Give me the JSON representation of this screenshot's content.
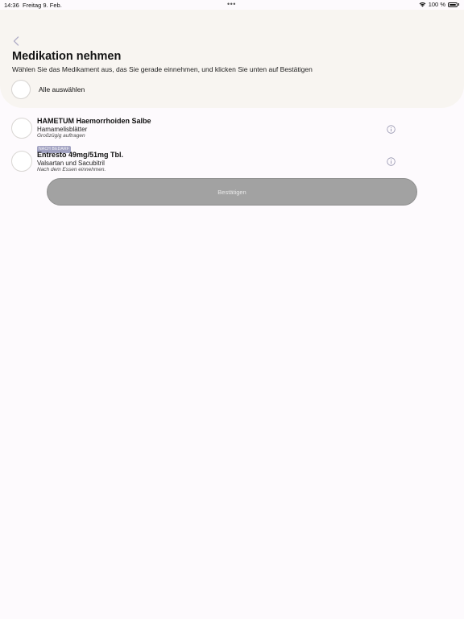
{
  "status_bar": {
    "time": "14:36",
    "date": "Freitag 9. Feb.",
    "dots": "•••",
    "battery": "100 %"
  },
  "header": {
    "title": "Medikation nehmen",
    "subtitle": "Wählen Sie das Medikament aus, das Sie gerade einnehmen, und klicken Sie unten auf Bestätigen",
    "select_all_label": "Alle auswählen"
  },
  "medications": [
    {
      "name": "HAMETUM Haemorrhoiden Salbe",
      "ingredient": "Hamamelisblätter",
      "note": "Großzügig auftragen",
      "badge": "NACH BEDARF"
    },
    {
      "name": "Entresto 49mg/51mg Tbl.",
      "ingredient": "Valsartan und Sacubitril",
      "note": "Nach dem Essen einnehmen."
    }
  ],
  "actions": {
    "confirm_label": "Bestätigen"
  },
  "colors": {
    "header_bg": "#f8f5f1",
    "page_bg": "#fdfafd",
    "badge_bg": "#a2a2c2",
    "button_disabled": "#a2a2a2",
    "info_icon": "#8a8aa6"
  }
}
